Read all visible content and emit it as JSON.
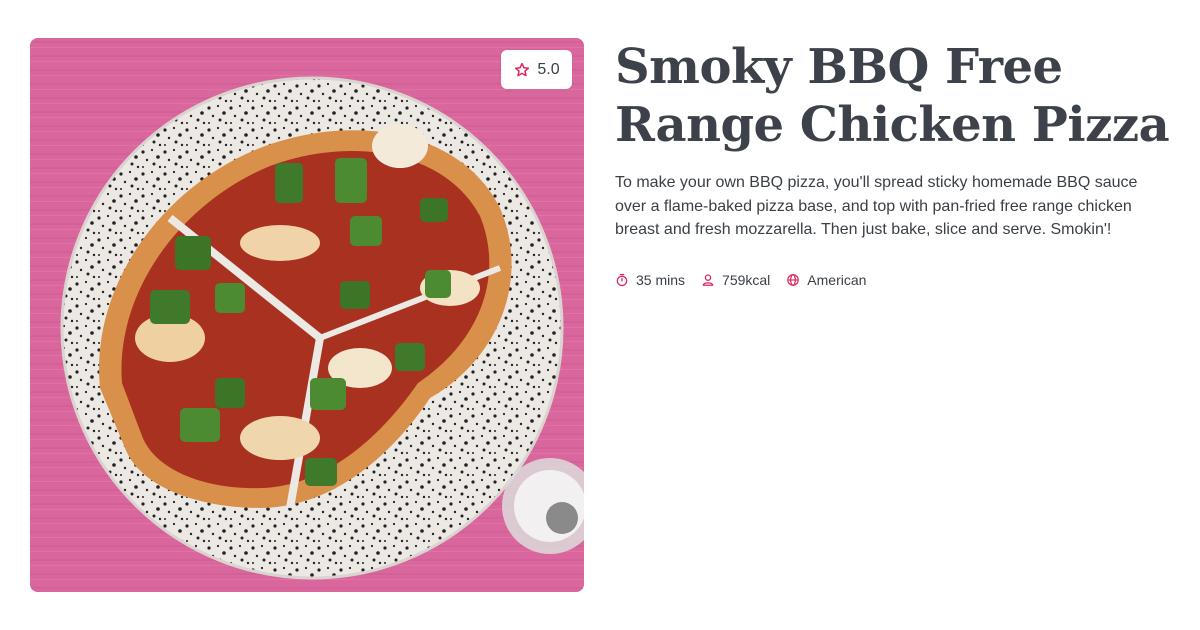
{
  "recipe": {
    "title": "Smoky BBQ Free Range Chicken Pizza",
    "description": "To make your own BBQ pizza, you'll spread sticky homemade BBQ sauce over a flame-baked pizza base, and top with pan-fried free range chicken breast and fresh mozzarella. Then just bake, slice and serve. Smokin'!",
    "rating": "5.0",
    "meta": {
      "time": "35 mins",
      "calories": "759kcal",
      "cuisine": "American"
    }
  },
  "icons": {
    "rating": "star-icon",
    "time": "stopwatch-icon",
    "calories": "person-icon",
    "cuisine": "globe-icon"
  },
  "colors": {
    "accent": "#e0245e",
    "title": "#3d424a",
    "text": "#3a3f47",
    "image_background": "#d9669c"
  }
}
